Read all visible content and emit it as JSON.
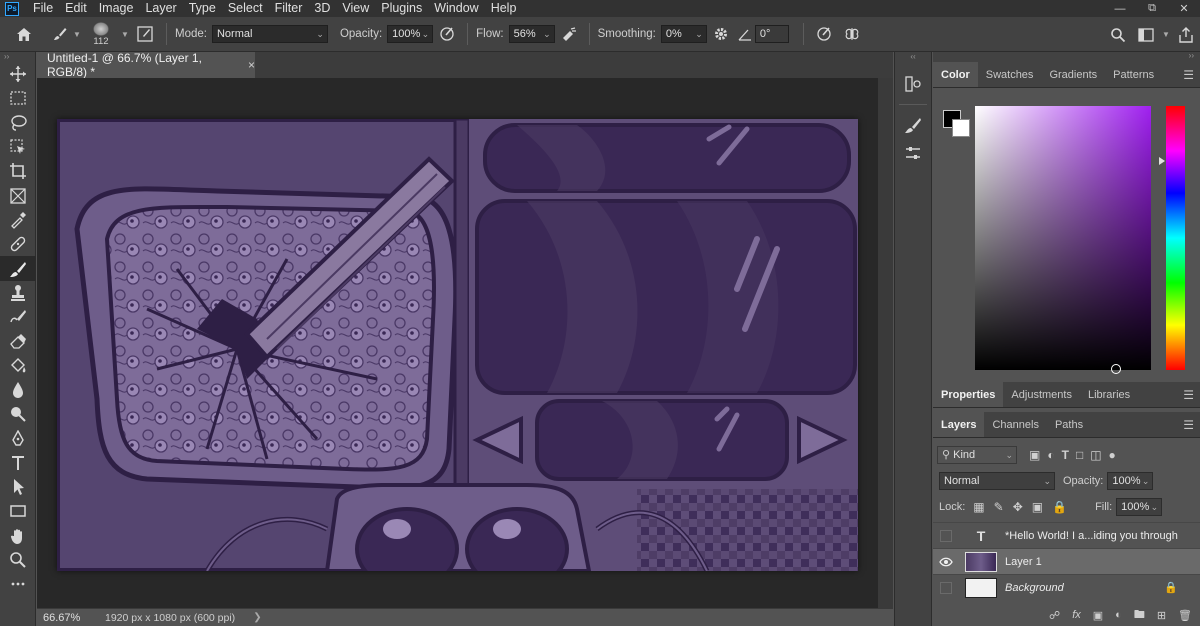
{
  "app": {
    "logo": "Ps",
    "menu": [
      "File",
      "Edit",
      "Image",
      "Layer",
      "Type",
      "Select",
      "Filter",
      "3D",
      "View",
      "Plugins",
      "Window",
      "Help"
    ],
    "window_controls": [
      "minimize-icon",
      "restore-icon",
      "close-icon"
    ]
  },
  "options_bar": {
    "brush_size": "112",
    "mode_label": "Mode:",
    "mode_value": "Normal",
    "opacity_label": "Opacity:",
    "opacity_value": "100%",
    "flow_label": "Flow:",
    "flow_value": "56%",
    "smoothing_label": "Smoothing:",
    "smoothing_value": "0%",
    "angle_value": "0°"
  },
  "document": {
    "tab_title": "Untitled-1 @ 66.7% (Layer 1, RGB/8) *",
    "close_glyph": "×",
    "zoom": "66.67%",
    "doc_info": "1920 px x 1080 px (600 ppi)"
  },
  "tools": [
    "move-tool",
    "marquee-tool",
    "lasso-tool",
    "object-select-tool",
    "crop-tool",
    "frame-tool",
    "eyedropper-tool",
    "healing-brush-tool",
    "brush-tool",
    "clone-stamp-tool",
    "history-brush-tool",
    "eraser-tool",
    "paint-bucket-tool",
    "blur-tool",
    "dodge-tool",
    "pen-tool",
    "type-tool",
    "path-select-tool",
    "rectangle-tool",
    "hand-tool",
    "zoom-tool",
    "more-tools"
  ],
  "color_panel": {
    "tabs": [
      "Color",
      "Swatches",
      "Gradients",
      "Patterns"
    ],
    "active_tab": 0,
    "foreground": "#000000",
    "background": "#ffffff",
    "hue_color": "#a020f0"
  },
  "properties_panel": {
    "tabs": [
      "Properties",
      "Adjustments",
      "Libraries"
    ],
    "active_tab": 0
  },
  "layers_panel": {
    "tabs": [
      "Layers",
      "Channels",
      "Paths"
    ],
    "active_tab": 0,
    "filter_label": "Kind",
    "blend_mode": "Normal",
    "opacity_label": "Opacity:",
    "opacity_value": "100%",
    "lock_label": "Lock:",
    "fill_label": "Fill:",
    "fill_value": "100%",
    "layers": [
      {
        "name": "*Hello World! I a...iding you through",
        "type": "text",
        "visible": false,
        "selected": false
      },
      {
        "name": "Layer 1",
        "type": "pixel",
        "visible": true,
        "selected": true
      },
      {
        "name": "Background",
        "type": "background",
        "visible": false,
        "selected": false,
        "locked": true
      }
    ]
  },
  "artwork": {
    "palette": {
      "base": "#5a4a73",
      "dark": "#2e1f45",
      "mid": "#6e5d8a",
      "light": "#9a88b5",
      "deep_purple": "#3a2855"
    }
  }
}
